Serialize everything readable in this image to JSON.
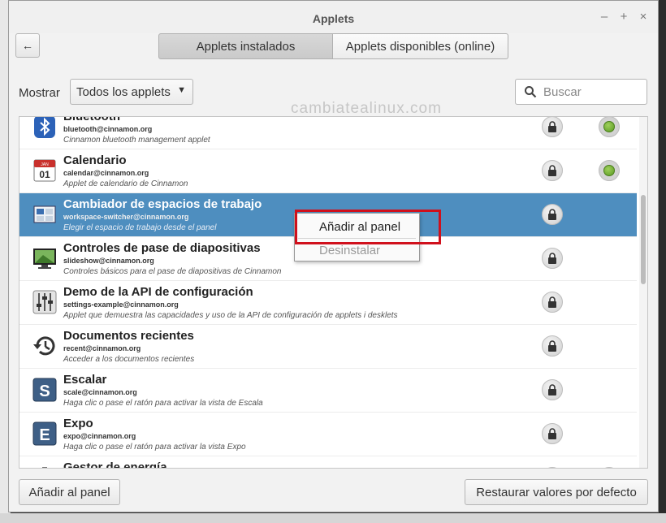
{
  "window": {
    "title": "Applets",
    "minimize_glyph": "–",
    "maximize_glyph": "+",
    "close_glyph": "×"
  },
  "toolbar": {
    "back_icon": "←"
  },
  "tabs": [
    {
      "label": "Applets instalados",
      "active": true
    },
    {
      "label": "Applets disponibles (online)",
      "active": false
    }
  ],
  "filter": {
    "label": "Mostrar",
    "selected": "Todos los applets",
    "arrow_icon": "▼"
  },
  "search": {
    "placeholder": "Buscar"
  },
  "watermark": "cambiatealinux.com",
  "applets": [
    {
      "name": "Bluetooth",
      "uuid": "bluetooth@cinnamon.org",
      "description": "Cinnamon bluetooth management applet",
      "icon": "bluetooth-icon",
      "active": true
    },
    {
      "name": "Calendario",
      "uuid": "calendar@cinnamon.org",
      "description": "Applet de calendario de Cinnamon",
      "icon": "calendar-icon",
      "icon_month": "JAN",
      "icon_day": "01",
      "active": true
    },
    {
      "name": "Cambiador de espacios de trabajo",
      "uuid": "workspace-switcher@cinnamon.org",
      "description": "Elegir el espacio de trabajo desde el panel",
      "icon": "workspace-switcher-icon",
      "active": false,
      "selected": true
    },
    {
      "name": "Controles de pase de diapositivas",
      "uuid": "slideshow@cinnamon.org",
      "description": "Controles básicos para el pase de diapositivas de Cinnamon",
      "icon": "slideshow-icon",
      "active": false
    },
    {
      "name": "Demo de la API de configuración",
      "uuid": "settings-example@cinnamon.org",
      "description": "Applet que demuestra las capacidades y uso de la API de configuración de applets i desklets",
      "icon": "settings-sliders-icon",
      "active": false
    },
    {
      "name": "Documentos recientes",
      "uuid": "recent@cinnamon.org",
      "description": "Acceder a los documentos recientes",
      "icon": "recent-documents-icon",
      "active": false
    },
    {
      "name": "Escalar",
      "uuid": "scale@cinnamon.org",
      "description": "Haga clic o pase el ratón para activar la vista de Escala",
      "icon": "scale-icon",
      "icon_letter": "S",
      "active": false
    },
    {
      "name": "Expo",
      "uuid": "expo@cinnamon.org",
      "description": "Haga clic o pase el ratón para activar la vista Expo",
      "icon": "expo-icon",
      "icon_letter": "E",
      "active": false
    },
    {
      "name": "Gestor de energía",
      "uuid": "",
      "description": "",
      "icon": "power-manager-icon",
      "active": true
    }
  ],
  "context_menu": {
    "add": "Añadir al panel",
    "uninstall": "Desinstalar"
  },
  "buttons": {
    "add_to_panel": "Añadir al panel",
    "restore_defaults": "Restaurar valores por defecto"
  },
  "colors": {
    "selection": "#4e8ebf",
    "highlight_border": "#d0101c",
    "active_green": "#5a9a23"
  }
}
